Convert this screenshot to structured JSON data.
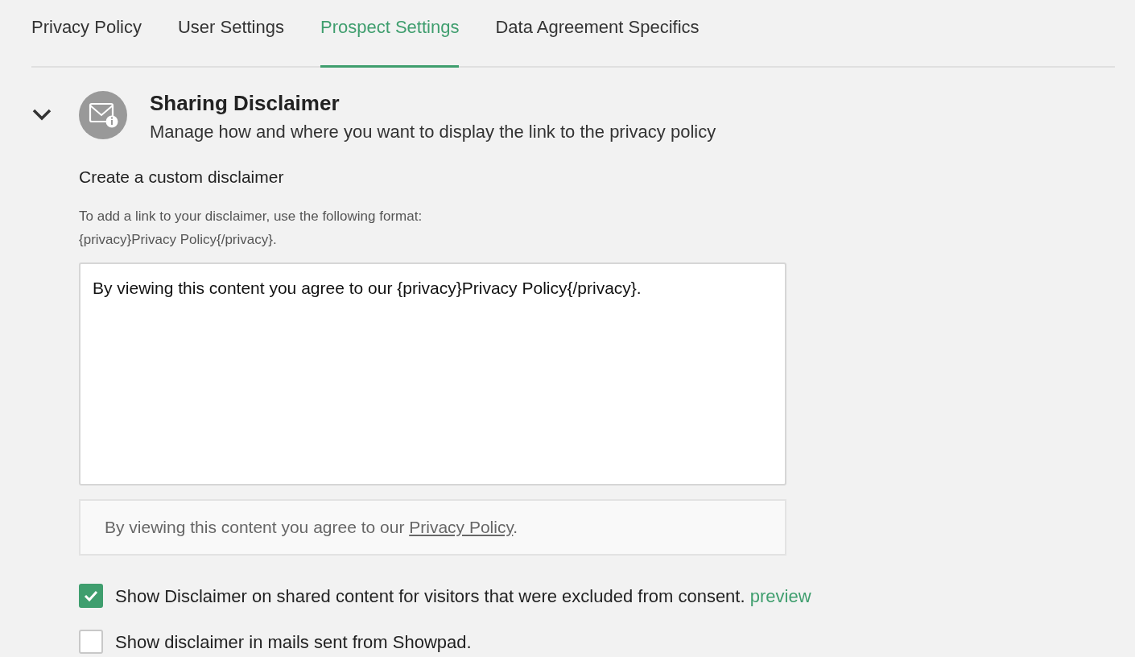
{
  "tabs": [
    {
      "label": "Privacy Policy",
      "selected": false
    },
    {
      "label": "User Settings",
      "selected": false
    },
    {
      "label": "Prospect Settings",
      "selected": true
    },
    {
      "label": "Data Agreement Specifics",
      "selected": false
    }
  ],
  "section": {
    "expanded": true,
    "title": "Sharing Disclaimer",
    "subtitle": "Manage how and where you want to display the link to the privacy policy",
    "field_label": "Create a custom disclaimer",
    "help_lines": [
      "To add a link to your disclaimer, use the following format:",
      "{privacy}Privacy Policy{/privacy}."
    ],
    "disclaimer_value": "By viewing this content you agree to our {privacy}Privacy Policy{/privacy}.",
    "preview": {
      "text_before": "By viewing this content you agree to our",
      "link": "Privacy Policy",
      "text_after": "."
    },
    "options": [
      {
        "label": "Show Disclaimer on shared content for visitors that were excluded from consent.",
        "checked": true,
        "link": "preview"
      },
      {
        "label": "Show disclaimer in mails sent from Showpad.",
        "checked": false
      }
    ]
  }
}
